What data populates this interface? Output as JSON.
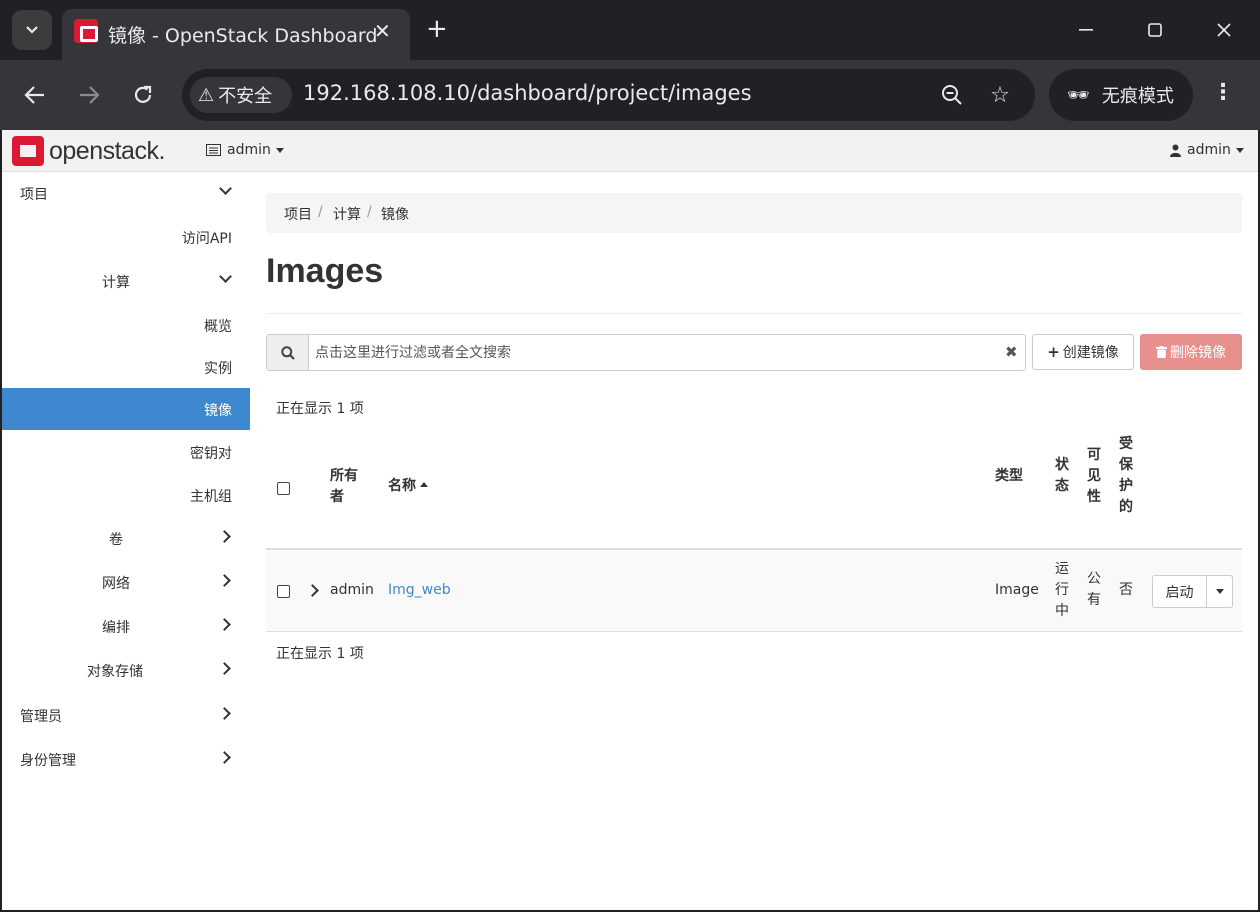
{
  "browser": {
    "tab_title": "镜像 - OpenStack Dashboard",
    "security_label": "不安全",
    "url": "192.168.108.10/dashboard/project/images",
    "incognito_label": "无痕模式"
  },
  "navbar": {
    "logo_text": "openstack.",
    "project_label": "admin",
    "user_label": "admin"
  },
  "sidebar": {
    "project": "项目",
    "api_access": "访问API",
    "compute": "计算",
    "overview": "概览",
    "instances": "实例",
    "images": "镜像",
    "key_pairs": "密钥对",
    "server_groups": "主机组",
    "volumes": "卷",
    "network": "网络",
    "orchestration": "编排",
    "object_store": "对象存储",
    "admin": "管理员",
    "identity": "身份管理"
  },
  "breadcrumb": {
    "items": [
      "项目",
      "计算",
      "镜像"
    ],
    "separator": "/"
  },
  "page": {
    "title": "Images"
  },
  "search": {
    "placeholder": "点击这里进行过滤或者全文搜索"
  },
  "actions": {
    "create": "创建镜像",
    "delete": "删除镜像"
  },
  "table": {
    "count_text": "正在显示 1 项",
    "headers": {
      "owner": [
        "所有",
        "者"
      ],
      "name": "名称",
      "type": "类型",
      "status": [
        "状",
        "态"
      ],
      "visibility": [
        "可",
        "见",
        "性"
      ],
      "protected": [
        "受",
        "保",
        "护",
        "的"
      ]
    },
    "rows": [
      {
        "owner": "admin",
        "name": "Img_web",
        "type": "Image",
        "status": [
          "运",
          "行",
          "中"
        ],
        "visibility": [
          "公",
          "有"
        ],
        "protected": "否",
        "action": "启动"
      }
    ]
  },
  "colors": {
    "accent": "#3d88cf",
    "brand": "#da1a32",
    "danger_disabled": "#e8908d"
  }
}
